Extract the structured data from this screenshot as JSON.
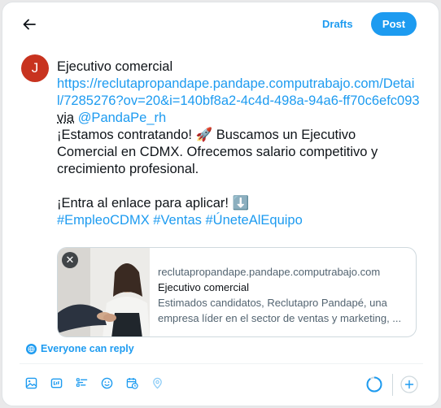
{
  "header": {
    "drafts_label": "Drafts",
    "post_label": "Post"
  },
  "author": {
    "avatar_initial": "J"
  },
  "tweet": {
    "title": "Ejecutivo comercial",
    "url": "https://reclutapropandape.pandape.computrabajo.com/Detail/7285276?ov=20&i=140bf8a2-4c4d-498a-94a6-ff70c6efc093",
    "via_word": "via",
    "mention": "@PandaPe_rh",
    "paragraph1": "¡Estamos contratando! 🚀 Buscamos un Ejecutivo Comercial en CDMX. Ofrecemos salario competitivo y crecimiento profesional.",
    "paragraph2": "¡Entra al enlace para aplicar! ⬇️",
    "hashtags": "#EmpleoCDMX #Ventas #ÚneteAlEquipo"
  },
  "link_card": {
    "domain": "reclutapropandape.pandape.computrabajo.com",
    "title": "Ejecutivo comercial",
    "description": "Estimados candidatos, Reclutapro Pandapé, una empresa líder en el sector de ventas y marketing, ..."
  },
  "reply_setting": "Everyone can reply",
  "toolbar": {
    "icons": [
      "image-icon",
      "gif-icon",
      "poll-icon",
      "emoji-icon",
      "schedule-icon",
      "location-icon"
    ]
  },
  "colors": {
    "accent": "#1d9bf0",
    "avatar_bg": "#c8331f",
    "text": "#0f1419",
    "muted": "#536471"
  }
}
